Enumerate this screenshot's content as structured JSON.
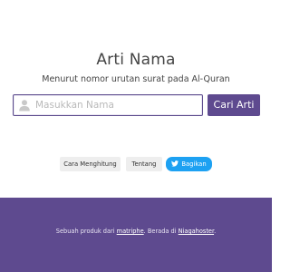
{
  "header": {
    "title": "Arti Nama",
    "subtitle": "Menurut nomor urutan surat pada Al-Quran"
  },
  "search": {
    "placeholder": "Masukkan Nama",
    "value": "",
    "button_label": "Cari Arti",
    "icon": "user-icon"
  },
  "links": {
    "how_it_works": "Cara Menghitung",
    "about": "Tentang",
    "share": "Bagikan",
    "share_icon": "twitter-bird-icon"
  },
  "footer": {
    "prefix": "Sebuah produk dari ",
    "author_link": "matriphe",
    "middle": ". Berada di ",
    "host_link": "Niagahoster",
    "suffix": "."
  },
  "colors": {
    "brand": "#5e4a8f",
    "twitter": "#1da1f2",
    "chip": "#eeeeee"
  }
}
